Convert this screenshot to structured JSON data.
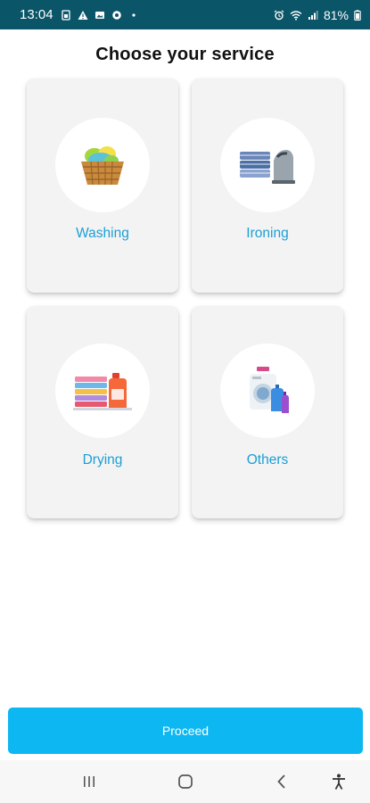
{
  "status_bar": {
    "time": "13:04",
    "left_icons": [
      "sim-card-icon",
      "warning-icon",
      "gallery-icon",
      "app-icon",
      "dot-icon"
    ],
    "right_icons": [
      "alarm-icon",
      "wifi-icon",
      "signal-icon"
    ],
    "battery": "81%"
  },
  "page": {
    "title": "Choose your service"
  },
  "services": [
    {
      "label": "Washing",
      "icon": "laundry-basket-icon"
    },
    {
      "label": "Ironing",
      "icon": "iron-clothes-icon"
    },
    {
      "label": "Drying",
      "icon": "folded-clothes-detergent-icon"
    },
    {
      "label": "Others",
      "icon": "washing-machine-bottles-icon"
    }
  ],
  "proceed": {
    "label": "Proceed"
  },
  "nav": {
    "buttons": [
      "recent-apps",
      "home",
      "back",
      "accessibility"
    ]
  },
  "colors": {
    "status_bar": "#0a5567",
    "accent": "#0db7f2",
    "label": "#1a9fd6",
    "card": "#f3f3f3"
  }
}
